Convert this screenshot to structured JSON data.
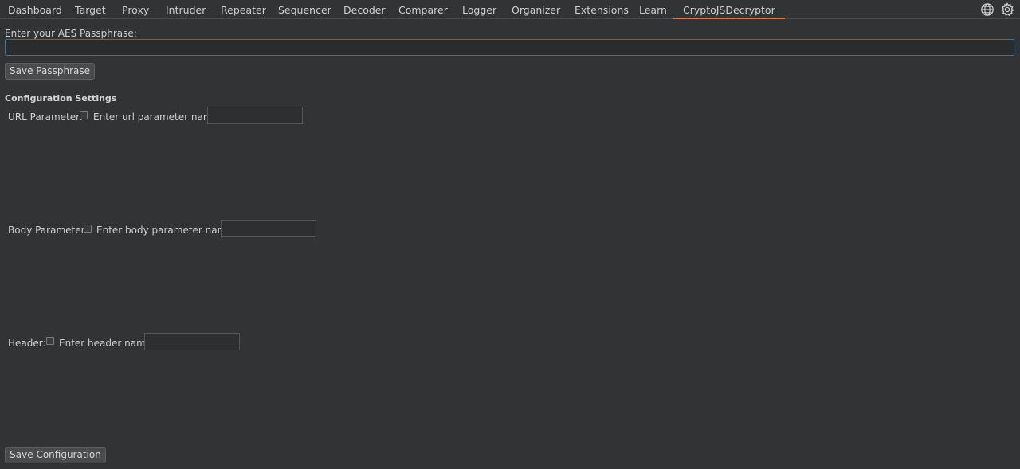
{
  "tabs": [
    {
      "label": "Dashboard"
    },
    {
      "label": "Target"
    },
    {
      "label": "Proxy"
    },
    {
      "label": "Intruder"
    },
    {
      "label": "Repeater"
    },
    {
      "label": "Sequencer"
    },
    {
      "label": "Decoder"
    },
    {
      "label": "Comparer"
    },
    {
      "label": "Logger"
    },
    {
      "label": "Organizer"
    },
    {
      "label": "Extensions"
    },
    {
      "label": "Learn"
    },
    {
      "label": "CryptoJSDecryptor",
      "active": true
    }
  ],
  "top_icons": [
    "globe-icon",
    "settings-icon"
  ],
  "colors": {
    "background": "#323335",
    "active_tab_accent": "#e8773d",
    "input_focus_border": "#4a6e8e"
  },
  "passphrase": {
    "label": "Enter your AES Passphrase:",
    "value": "",
    "save_button": "Save Passphrase"
  },
  "config": {
    "title": "Configuration Settings",
    "url": {
      "label": "URL Parameter:",
      "checked": false,
      "name_label": "Enter url parameter name:",
      "value": ""
    },
    "body": {
      "label": "Body Parameter:",
      "checked": false,
      "name_label": "Enter body parameter name:",
      "value": ""
    },
    "header": {
      "label": "Header:",
      "checked": false,
      "name_label": "Enter header name:",
      "value": ""
    },
    "save_button": "Save Configuration"
  }
}
